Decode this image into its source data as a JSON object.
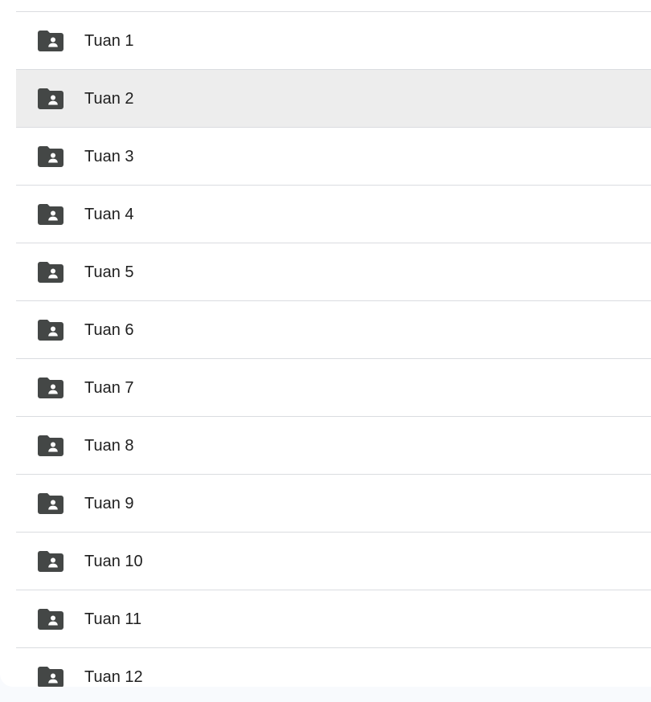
{
  "folder_list": {
    "items": [
      {
        "label": "Tuan 1",
        "icon": "shared-folder-icon",
        "selected": false
      },
      {
        "label": "Tuan 2",
        "icon": "shared-folder-icon",
        "selected": true
      },
      {
        "label": "Tuan 3",
        "icon": "shared-folder-icon",
        "selected": false
      },
      {
        "label": "Tuan 4",
        "icon": "shared-folder-icon",
        "selected": false
      },
      {
        "label": "Tuan 5",
        "icon": "shared-folder-icon",
        "selected": false
      },
      {
        "label": "Tuan 6",
        "icon": "shared-folder-icon",
        "selected": false
      },
      {
        "label": "Tuan 7",
        "icon": "shared-folder-icon",
        "selected": false
      },
      {
        "label": "Tuan 8",
        "icon": "shared-folder-icon",
        "selected": false
      },
      {
        "label": "Tuan 9",
        "icon": "shared-folder-icon",
        "selected": false
      },
      {
        "label": "Tuan 10",
        "icon": "shared-folder-icon",
        "selected": false
      },
      {
        "label": "Tuan 11",
        "icon": "shared-folder-icon",
        "selected": false
      },
      {
        "label": "Tuan 12",
        "icon": "shared-folder-icon",
        "selected": false
      }
    ]
  },
  "colors": {
    "icon": "#444746",
    "selected_row_bg": "#ededed",
    "divider": "#dadce0",
    "text": "#1f1f1f"
  }
}
